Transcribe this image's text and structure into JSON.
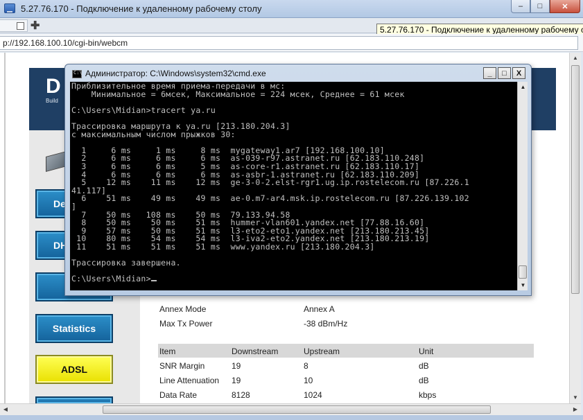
{
  "rdp_window": {
    "title": "5.27.76.170 - Подключение к удаленному рабочему столу",
    "buttons": {
      "minimize": "‒",
      "maximize": "□",
      "close": "✕"
    },
    "icon": "remote-desktop-icon"
  },
  "browser": {
    "tooltip": "5.27.76.170 - Подключение к удаленному рабочему столу",
    "new_tab": "✚",
    "address": "p://192.168.100.10/cgi-bin/webcm"
  },
  "router_page": {
    "logo": "D",
    "logo_tagline": "Build",
    "nav": [
      {
        "label": "De",
        "active": false
      },
      {
        "label": "DHC",
        "active": false
      },
      {
        "label": "",
        "active": false
      },
      {
        "label": "Statistics",
        "active": false
      },
      {
        "label": "ADSL",
        "active": true
      }
    ],
    "status": [
      {
        "label": "Annex Mode",
        "value": "Annex A"
      },
      {
        "label": "Max Tx Power",
        "value": "-38 dBm/Hz"
      }
    ],
    "table": {
      "headers": [
        "Item",
        "Downstream",
        "Upstream",
        "Unit"
      ],
      "rows": [
        [
          "SNR Margin",
          "19",
          "8",
          "dB"
        ],
        [
          "Line Attenuation",
          "19",
          "10",
          "dB"
        ],
        [
          "Data Rate",
          "8128",
          "1024",
          "kbps"
        ]
      ]
    }
  },
  "cmd_window": {
    "title": "Администратор: C:\\Windows\\system32\\cmd.exe",
    "buttons": {
      "minimize": "_",
      "maximize": "□",
      "close": "X"
    },
    "lines": [
      "Приблизительное время приема-передачи в мс:",
      "    Минимальное = 6мсек, Максимальное = 224 мсек, Среднее = 61 мсек",
      "",
      "C:\\Users\\Midian>tracert ya.ru",
      "",
      "Трассировка маршрута к ya.ru [213.180.204.3]",
      "с максимальным числом прыжков 30:",
      "",
      "  1     6 ms     1 ms     8 ms  mygateway1.ar7 [192.168.100.10]",
      "  2     6 ms     6 ms     6 ms  as-039-r97.astranet.ru [62.183.110.248]",
      "  3     6 ms     6 ms     5 ms  as-core-r1.astranet.ru [62.183.110.17]",
      "  4     6 ms     6 ms     6 ms  as-asbr-1.astranet.ru [62.183.110.209]",
      "  5    12 ms    11 ms    12 ms  ge-3-0-2.elst-rgr1.ug.ip.rostelecom.ru [87.226.1",
      "41.117]",
      "  6    51 ms    49 ms    49 ms  ae-0.m7-ar4.msk.ip.rostelecom.ru [87.226.139.102",
      "]",
      "  7    50 ms   108 ms    50 ms  79.133.94.58",
      "  8    50 ms    50 ms    51 ms  hummer-vlan601.yandex.net [77.88.16.60]",
      "  9    57 ms    50 ms    51 ms  l3-eto2-eto1.yandex.net [213.180.213.45]",
      " 10    80 ms    54 ms    54 ms  l3-iva2-eto2.yandex.net [213.180.213.19]",
      " 11    51 ms    51 ms    51 ms  www.yandex.ru [213.180.204.3]",
      "",
      "Трассировка завершена.",
      ""
    ],
    "prompt": "C:\\Users\\Midian>"
  }
}
